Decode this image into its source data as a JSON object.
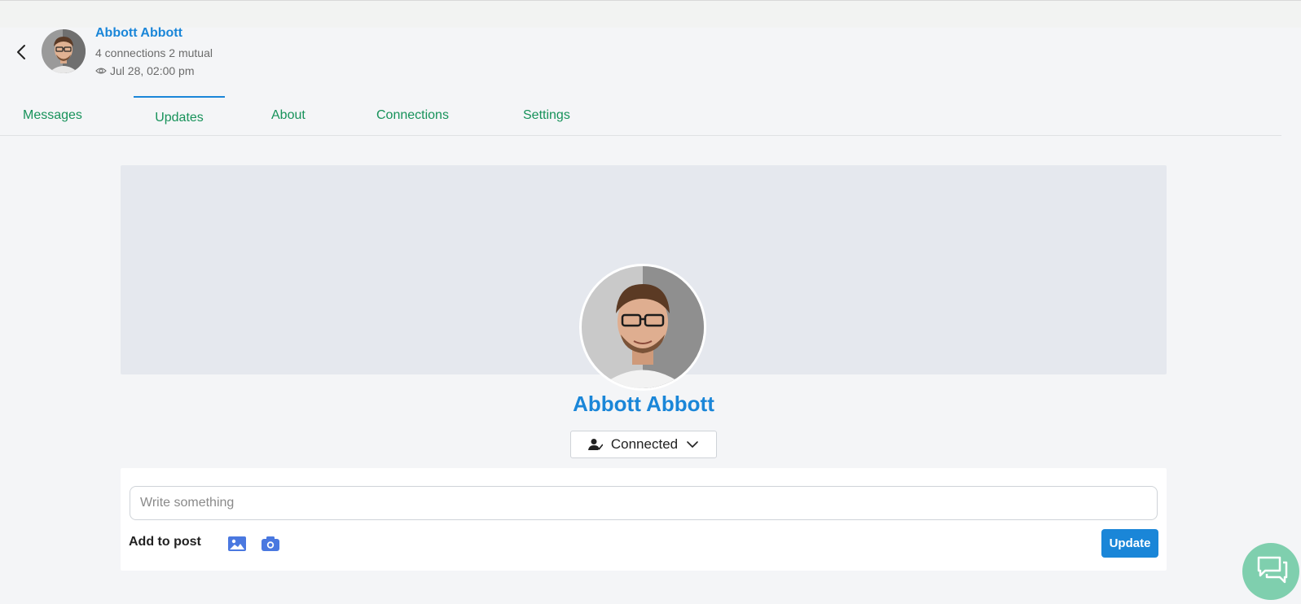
{
  "header": {
    "name": "Abbott Abbott",
    "connections_text": "4 connections 2 mutual",
    "last_seen": "Jul 28, 02:00 pm"
  },
  "tabs": [
    {
      "label": "Messages",
      "active": false
    },
    {
      "label": "Updates",
      "active": true
    },
    {
      "label": "About",
      "active": false
    },
    {
      "label": "Connections",
      "active": false
    },
    {
      "label": "Settings",
      "active": false
    }
  ],
  "profile": {
    "name": "Abbott Abbott",
    "connection_status": "Connected"
  },
  "composer": {
    "placeholder": "Write something",
    "value": "",
    "add_to_post_label": "Add to post",
    "submit_label": "Update"
  },
  "icons": {
    "back": "chevron-left-icon",
    "seen": "eye-icon",
    "connected": "user-check-icon",
    "dropdown": "chevron-down-icon",
    "image": "image-icon",
    "camera": "camera-icon",
    "chat": "chat-bubbles-icon"
  },
  "colors": {
    "brand_blue": "#1a86d8",
    "tab_green": "#17925a",
    "cover_gray": "#e5e8ee",
    "chat_fab": "#7fcfae",
    "attach_icon": "#4a78e0"
  }
}
